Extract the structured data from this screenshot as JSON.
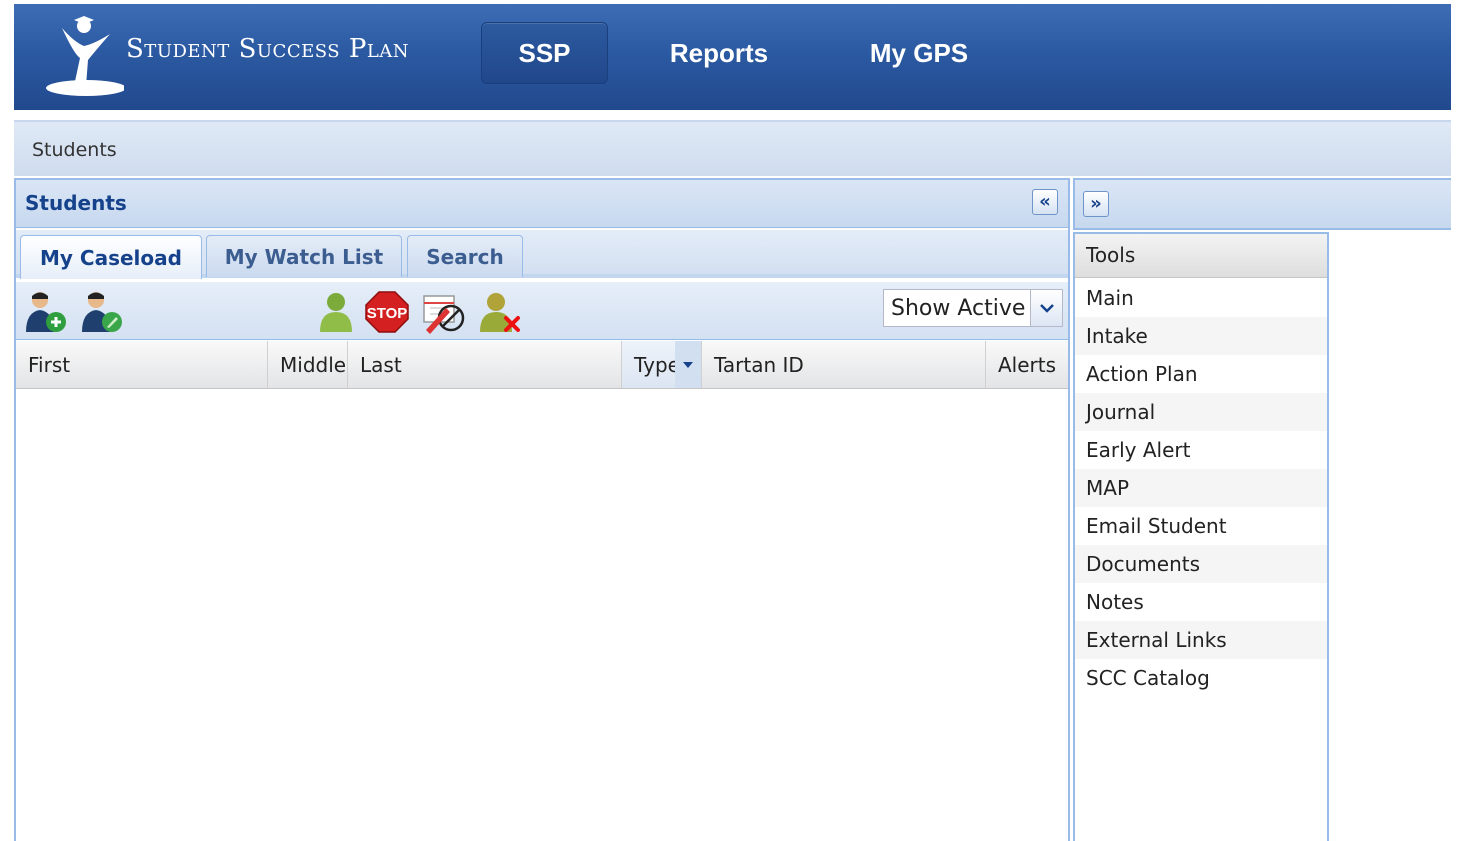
{
  "header": {
    "logo_text": "Student Success Plan",
    "nav": {
      "ssp": "SSP",
      "reports": "Reports",
      "gps": "My GPS"
    }
  },
  "breadcrumb": "Students",
  "students": {
    "title": "Students",
    "tabs": [
      "My Caseload",
      "My Watch List",
      "Search"
    ],
    "active_tab": "My Caseload",
    "stop_label": "STOP",
    "filter": {
      "selected": "Show Active"
    },
    "columns": {
      "first": "First",
      "middle": "Middle",
      "last": "Last",
      "type": "Type",
      "tartan_id": "Tartan ID",
      "alerts": "Alerts"
    },
    "rows": []
  },
  "tools": {
    "title": "Tools",
    "items": [
      "Main",
      "Intake",
      "Action Plan",
      "Journal",
      "Early Alert",
      "MAP",
      "Email Student",
      "Documents",
      "Notes",
      "External Links",
      "SCC Catalog"
    ]
  },
  "colors": {
    "header_blue": "#2b5aa2",
    "panel_border": "#99bbe8",
    "title_blue": "#15428b"
  }
}
